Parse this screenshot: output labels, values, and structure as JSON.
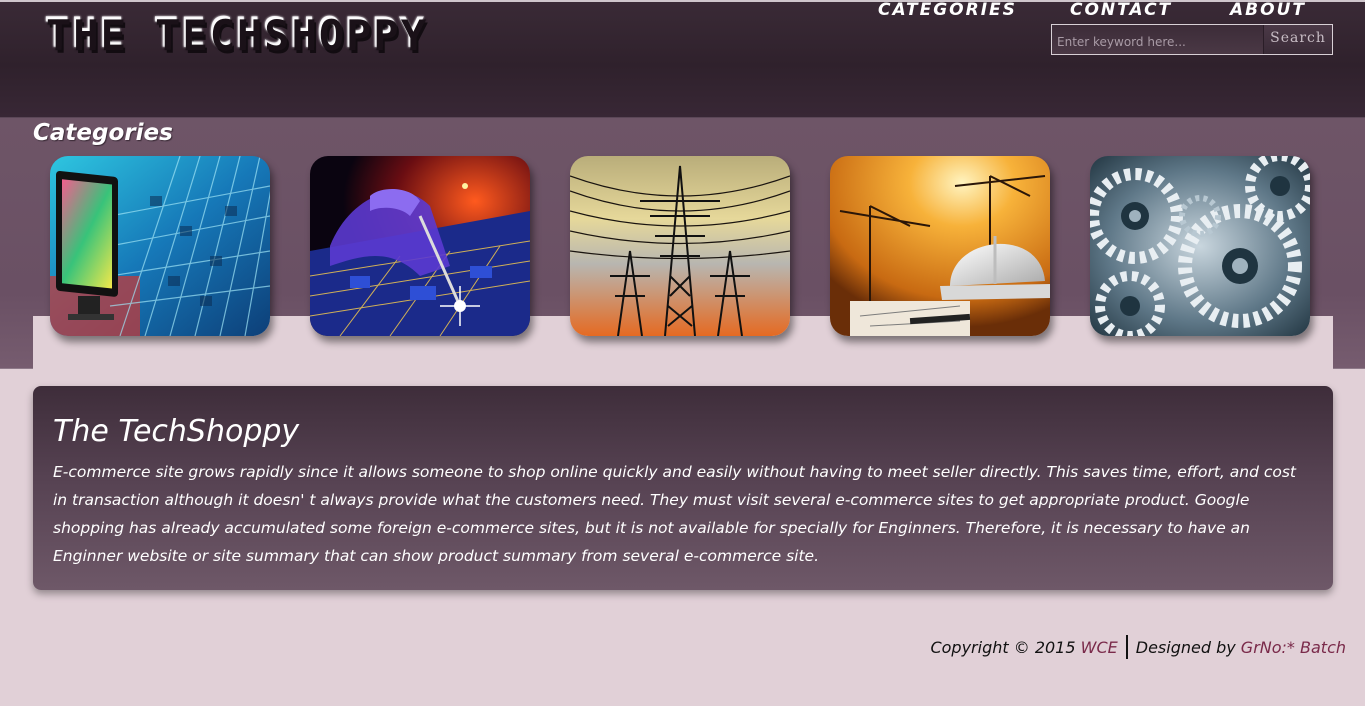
{
  "header": {
    "logo": "THE TECHSHOPPY",
    "search": {
      "placeholder": "Enter keyword here...",
      "button_label": "Search"
    },
    "nav": [
      {
        "label": "CATEGORIES"
      },
      {
        "label": "CONTACT"
      },
      {
        "label": "ABOUT"
      }
    ]
  },
  "categories": {
    "title": "Categories",
    "items": [
      {
        "icon": "computer-keyboard-image"
      },
      {
        "icon": "circuit-board-image"
      },
      {
        "icon": "power-tower-image"
      },
      {
        "icon": "construction-helmet-image"
      },
      {
        "icon": "gears-image"
      }
    ]
  },
  "about": {
    "title": "The TechShoppy",
    "text": "E-commerce site grows rapidly since it allows someone to shop online quickly and easily without having to meet seller directly. This saves time, effort, and cost in transaction although it doesn' t always provide what the customers need. They must visit several e-commerce sites to get appropriate product. Google shopping has already accumulated some foreign e-commerce sites, but it is not available for specially for Enginners. Therefore, it is necessary to have an Enginner website or site summary that can show product summary from several e-commerce site."
  },
  "footer": {
    "copyright": "Copyright © 2015",
    "org_link": "WCE",
    "designed_by": "Designed by",
    "batch_link": "GrNo:* Batch"
  },
  "colors": {
    "header_bg": "#2f212c",
    "band_bg": "#6e5567",
    "page_bg": "#e1d0d7",
    "link": "#7a2a4a"
  }
}
